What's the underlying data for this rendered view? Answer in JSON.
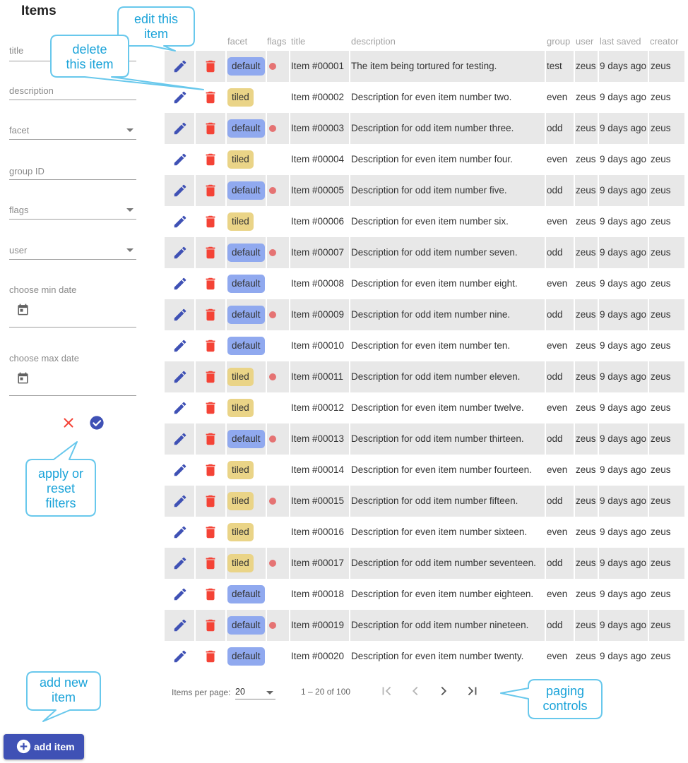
{
  "page_title": "Items",
  "filters": {
    "title_label": "title",
    "description_label": "description",
    "facet_label": "facet",
    "group_label": "group ID",
    "flags_label": "flags",
    "user_label": "user",
    "min_date_label": "choose min date",
    "max_date_label": "choose max date"
  },
  "table": {
    "headers": {
      "facet": "facet",
      "flags": "flags",
      "title": "title",
      "description": "description",
      "group": "group",
      "user": "user",
      "last_saved": "last saved",
      "creator": "creator"
    },
    "rows": [
      {
        "facet": "default",
        "flag": true,
        "title": "Item #00001",
        "description": "The item being tortured for testing.",
        "group": "test",
        "user": "zeus",
        "last_saved": "9 days ago",
        "creator": "zeus"
      },
      {
        "facet": "tiled",
        "flag": false,
        "title": "Item #00002",
        "description": "Description for even item number two.",
        "group": "even",
        "user": "zeus",
        "last_saved": "9 days ago",
        "creator": "zeus"
      },
      {
        "facet": "default",
        "flag": true,
        "title": "Item #00003",
        "description": "Description for odd item number three.",
        "group": "odd",
        "user": "zeus",
        "last_saved": "9 days ago",
        "creator": "zeus"
      },
      {
        "facet": "tiled",
        "flag": false,
        "title": "Item #00004",
        "description": "Description for even item number four.",
        "group": "even",
        "user": "zeus",
        "last_saved": "9 days ago",
        "creator": "zeus"
      },
      {
        "facet": "default",
        "flag": true,
        "title": "Item #00005",
        "description": "Description for odd item number five.",
        "group": "odd",
        "user": "zeus",
        "last_saved": "9 days ago",
        "creator": "zeus"
      },
      {
        "facet": "tiled",
        "flag": false,
        "title": "Item #00006",
        "description": "Description for even item number six.",
        "group": "even",
        "user": "zeus",
        "last_saved": "9 days ago",
        "creator": "zeus"
      },
      {
        "facet": "default",
        "flag": true,
        "title": "Item #00007",
        "description": "Description for odd item number seven.",
        "group": "odd",
        "user": "zeus",
        "last_saved": "9 days ago",
        "creator": "zeus"
      },
      {
        "facet": "default",
        "flag": false,
        "title": "Item #00008",
        "description": "Description for even item number eight.",
        "group": "even",
        "user": "zeus",
        "last_saved": "9 days ago",
        "creator": "zeus"
      },
      {
        "facet": "default",
        "flag": true,
        "title": "Item #00009",
        "description": "Description for odd item number nine.",
        "group": "odd",
        "user": "zeus",
        "last_saved": "9 days ago",
        "creator": "zeus"
      },
      {
        "facet": "default",
        "flag": false,
        "title": "Item #00010",
        "description": "Description for even item number ten.",
        "group": "even",
        "user": "zeus",
        "last_saved": "9 days ago",
        "creator": "zeus"
      },
      {
        "facet": "tiled",
        "flag": true,
        "title": "Item #00011",
        "description": "Description for odd item number eleven.",
        "group": "odd",
        "user": "zeus",
        "last_saved": "9 days ago",
        "creator": "zeus"
      },
      {
        "facet": "tiled",
        "flag": false,
        "title": "Item #00012",
        "description": "Description for even item number twelve.",
        "group": "even",
        "user": "zeus",
        "last_saved": "9 days ago",
        "creator": "zeus"
      },
      {
        "facet": "default",
        "flag": true,
        "title": "Item #00013",
        "description": "Description for odd item number thirteen.",
        "group": "odd",
        "user": "zeus",
        "last_saved": "9 days ago",
        "creator": "zeus"
      },
      {
        "facet": "tiled",
        "flag": false,
        "title": "Item #00014",
        "description": "Description for even item number fourteen.",
        "group": "even",
        "user": "zeus",
        "last_saved": "9 days ago",
        "creator": "zeus"
      },
      {
        "facet": "tiled",
        "flag": true,
        "title": "Item #00015",
        "description": "Description for odd item number fifteen.",
        "group": "odd",
        "user": "zeus",
        "last_saved": "9 days ago",
        "creator": "zeus"
      },
      {
        "facet": "tiled",
        "flag": false,
        "title": "Item #00016",
        "description": "Description for even item number sixteen.",
        "group": "even",
        "user": "zeus",
        "last_saved": "9 days ago",
        "creator": "zeus"
      },
      {
        "facet": "tiled",
        "flag": true,
        "title": "Item #00017",
        "description": "Description for odd item number seventeen.",
        "group": "odd",
        "user": "zeus",
        "last_saved": "9 days ago",
        "creator": "zeus"
      },
      {
        "facet": "default",
        "flag": false,
        "title": "Item #00018",
        "description": "Description for even item number eighteen.",
        "group": "even",
        "user": "zeus",
        "last_saved": "9 days ago",
        "creator": "zeus"
      },
      {
        "facet": "default",
        "flag": true,
        "title": "Item #00019",
        "description": "Description for odd item number nineteen.",
        "group": "odd",
        "user": "zeus",
        "last_saved": "9 days ago",
        "creator": "zeus"
      },
      {
        "facet": "default",
        "flag": false,
        "title": "Item #00020",
        "description": "Description for even item number twenty.",
        "group": "even",
        "user": "zeus",
        "last_saved": "9 days ago",
        "creator": "zeus"
      }
    ]
  },
  "pager": {
    "items_per_page_label": "Items per page:",
    "items_per_page_value": "20",
    "range_label": "1 – 20 of 100",
    "buttons": [
      "first-page-icon",
      "previous-page-icon",
      "next-page-icon",
      "last-page-icon"
    ]
  },
  "add_button_label": "add item",
  "callouts": {
    "edit": [
      "edit this",
      "item"
    ],
    "delete": [
      "delete",
      "this item"
    ],
    "filters": [
      "apply or",
      "reset",
      "filters"
    ],
    "add": [
      "add new",
      "item"
    ],
    "paging": [
      "paging",
      "controls"
    ]
  },
  "icons": {
    "edit": "pencil-icon",
    "delete": "trash-icon",
    "calendar": "calendar-icon",
    "reset": "close-icon",
    "apply": "check-circle-icon",
    "add": "plus-circle-icon"
  },
  "colors": {
    "primary": "#3f51b5",
    "delete": "#f44336",
    "chip_default": "#90a9ef",
    "chip_tiled": "#ead487",
    "flag": "#e57373",
    "row_stripe": "#e8e8e8",
    "callout_text": "#1aa3d9",
    "callout_border": "#68c8ec"
  }
}
